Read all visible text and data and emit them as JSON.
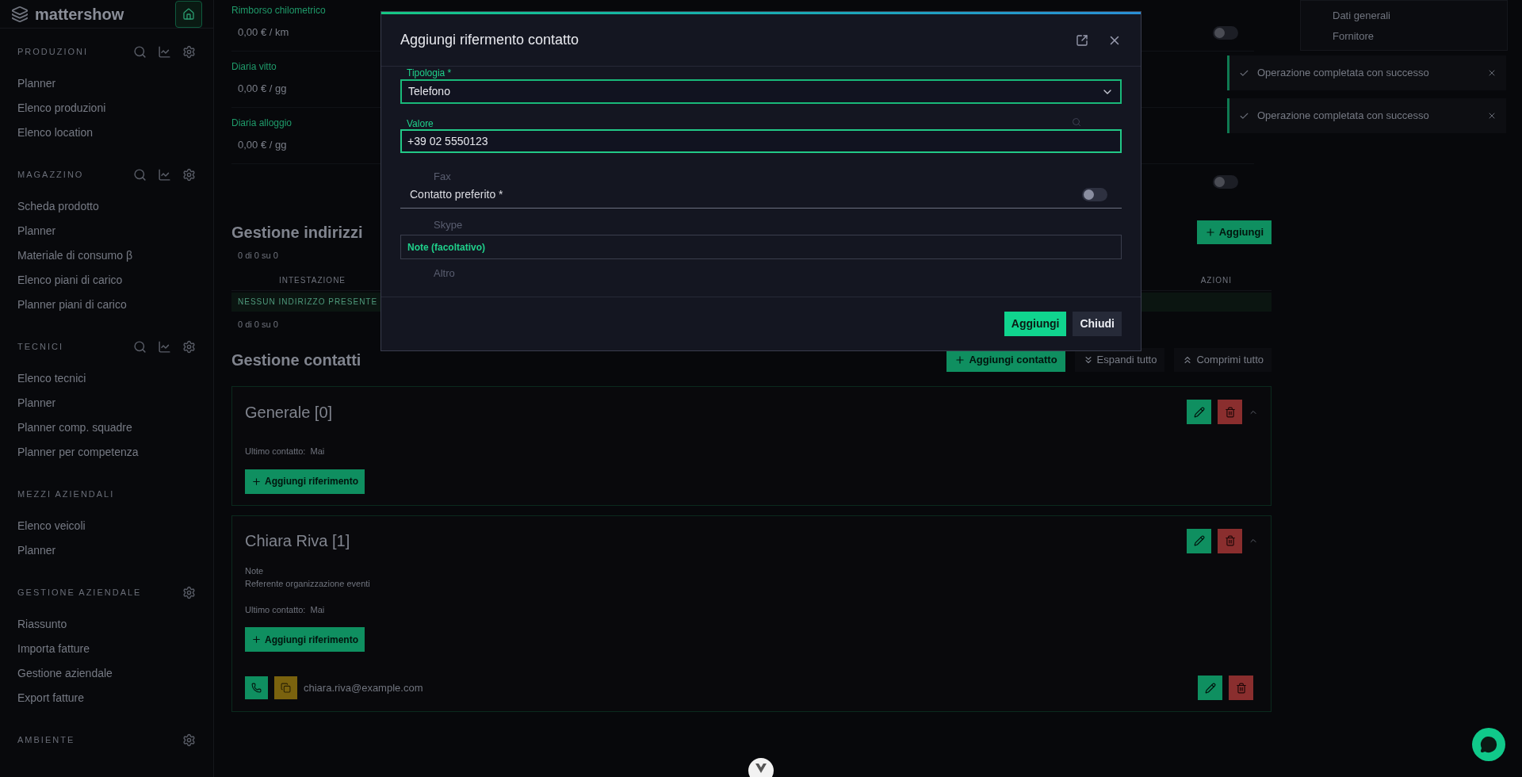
{
  "sidebar": {
    "logo": "mattershow",
    "sections": [
      {
        "title": "PRODUZIONI",
        "kind": "tools",
        "items": [
          "Planner",
          "Elenco produzioni",
          "Elenco location"
        ]
      },
      {
        "title": "MAGAZZINO",
        "kind": "tools",
        "items": [
          "Scheda prodotto",
          "Planner",
          "Materiale di consumo β",
          "Elenco piani di carico",
          "Planner piani di carico"
        ]
      },
      {
        "title": "TECNICI",
        "kind": "tools",
        "items": [
          "Elenco tecnici",
          "Planner",
          "Planner comp. squadre",
          "Planner per competenza"
        ]
      },
      {
        "title": "MEZZI AZIENDALI",
        "kind": "plain",
        "items": [
          "Elenco veicoli",
          "Planner"
        ]
      },
      {
        "title": "GESTIONE AZIENDALE",
        "kind": "settings",
        "items": [
          "Riassunto",
          "Importa fatture",
          "Gestione aziendale",
          "Export fatture"
        ]
      },
      {
        "title": "AMBIENTE",
        "kind": "settings"
      }
    ]
  },
  "rates": [
    {
      "label": "Rimborso chilometrico",
      "value": "0,00 € / km"
    },
    {
      "label": "Diaria vitto",
      "value": "0,00 € / gg"
    },
    {
      "label": "Diaria alloggio",
      "value": "0,00 € / gg"
    }
  ],
  "switches": [
    {
      "on": false
    },
    {
      "on": false
    }
  ],
  "addresses": {
    "title": "Gestione indirizzi",
    "add_button": "Aggiungi",
    "range_top": "0 di 0 su 0",
    "columns": [
      "INTESTAZIONE",
      "AZIONI"
    ],
    "empty_row": "NESSUN INDIRIZZO PRESENTE",
    "range_bottom": "0 di 0 su 0"
  },
  "contacts": {
    "title": "Gestione contatti",
    "buttons": [
      {
        "label": "Aggiungi contatto",
        "kind": "primary"
      },
      {
        "label": "Espandi tutto",
        "kind": "expand"
      },
      {
        "label": "Comprimi tutto",
        "kind": "collapse"
      }
    ],
    "groups": [
      {
        "name": "Generale [0]",
        "last_contact": "Ultimo contatto:  Mai",
        "add_button": "Aggiungi riferimento"
      },
      {
        "name": "Chiara Riva [1]",
        "note_label": "Note",
        "note": "Referente organizzazione eventi",
        "last_contact": "Ultimo contatto:  Mai",
        "add_button": "Aggiungi riferimento",
        "references": [
          {
            "value": "chiara.riva@example.com"
          }
        ]
      }
    ]
  },
  "side_menu": {
    "items": [
      "Dati generali",
      "Fornitore"
    ]
  },
  "toasts": [
    {
      "message": "Operazione completata con successo"
    },
    {
      "message": "Operazione completata con successo"
    }
  ],
  "modal": {
    "title": "Aggiungi rifermento contatto",
    "type_field": {
      "label": "Tipologia *",
      "value": "Telefono"
    },
    "value_field": {
      "label": "Valore",
      "value": "+39 02 5550123"
    },
    "options": [
      "Fax",
      "Skype",
      "Altro"
    ],
    "preferred": {
      "label": "Contatto preferito *",
      "on": false
    },
    "note_field": {
      "placeholder": "Note (facoltativo)"
    },
    "buttons": [
      {
        "label": "Aggiungi",
        "kind": "primary"
      },
      {
        "label": "Chiudi",
        "kind": "secondary"
      }
    ]
  }
}
